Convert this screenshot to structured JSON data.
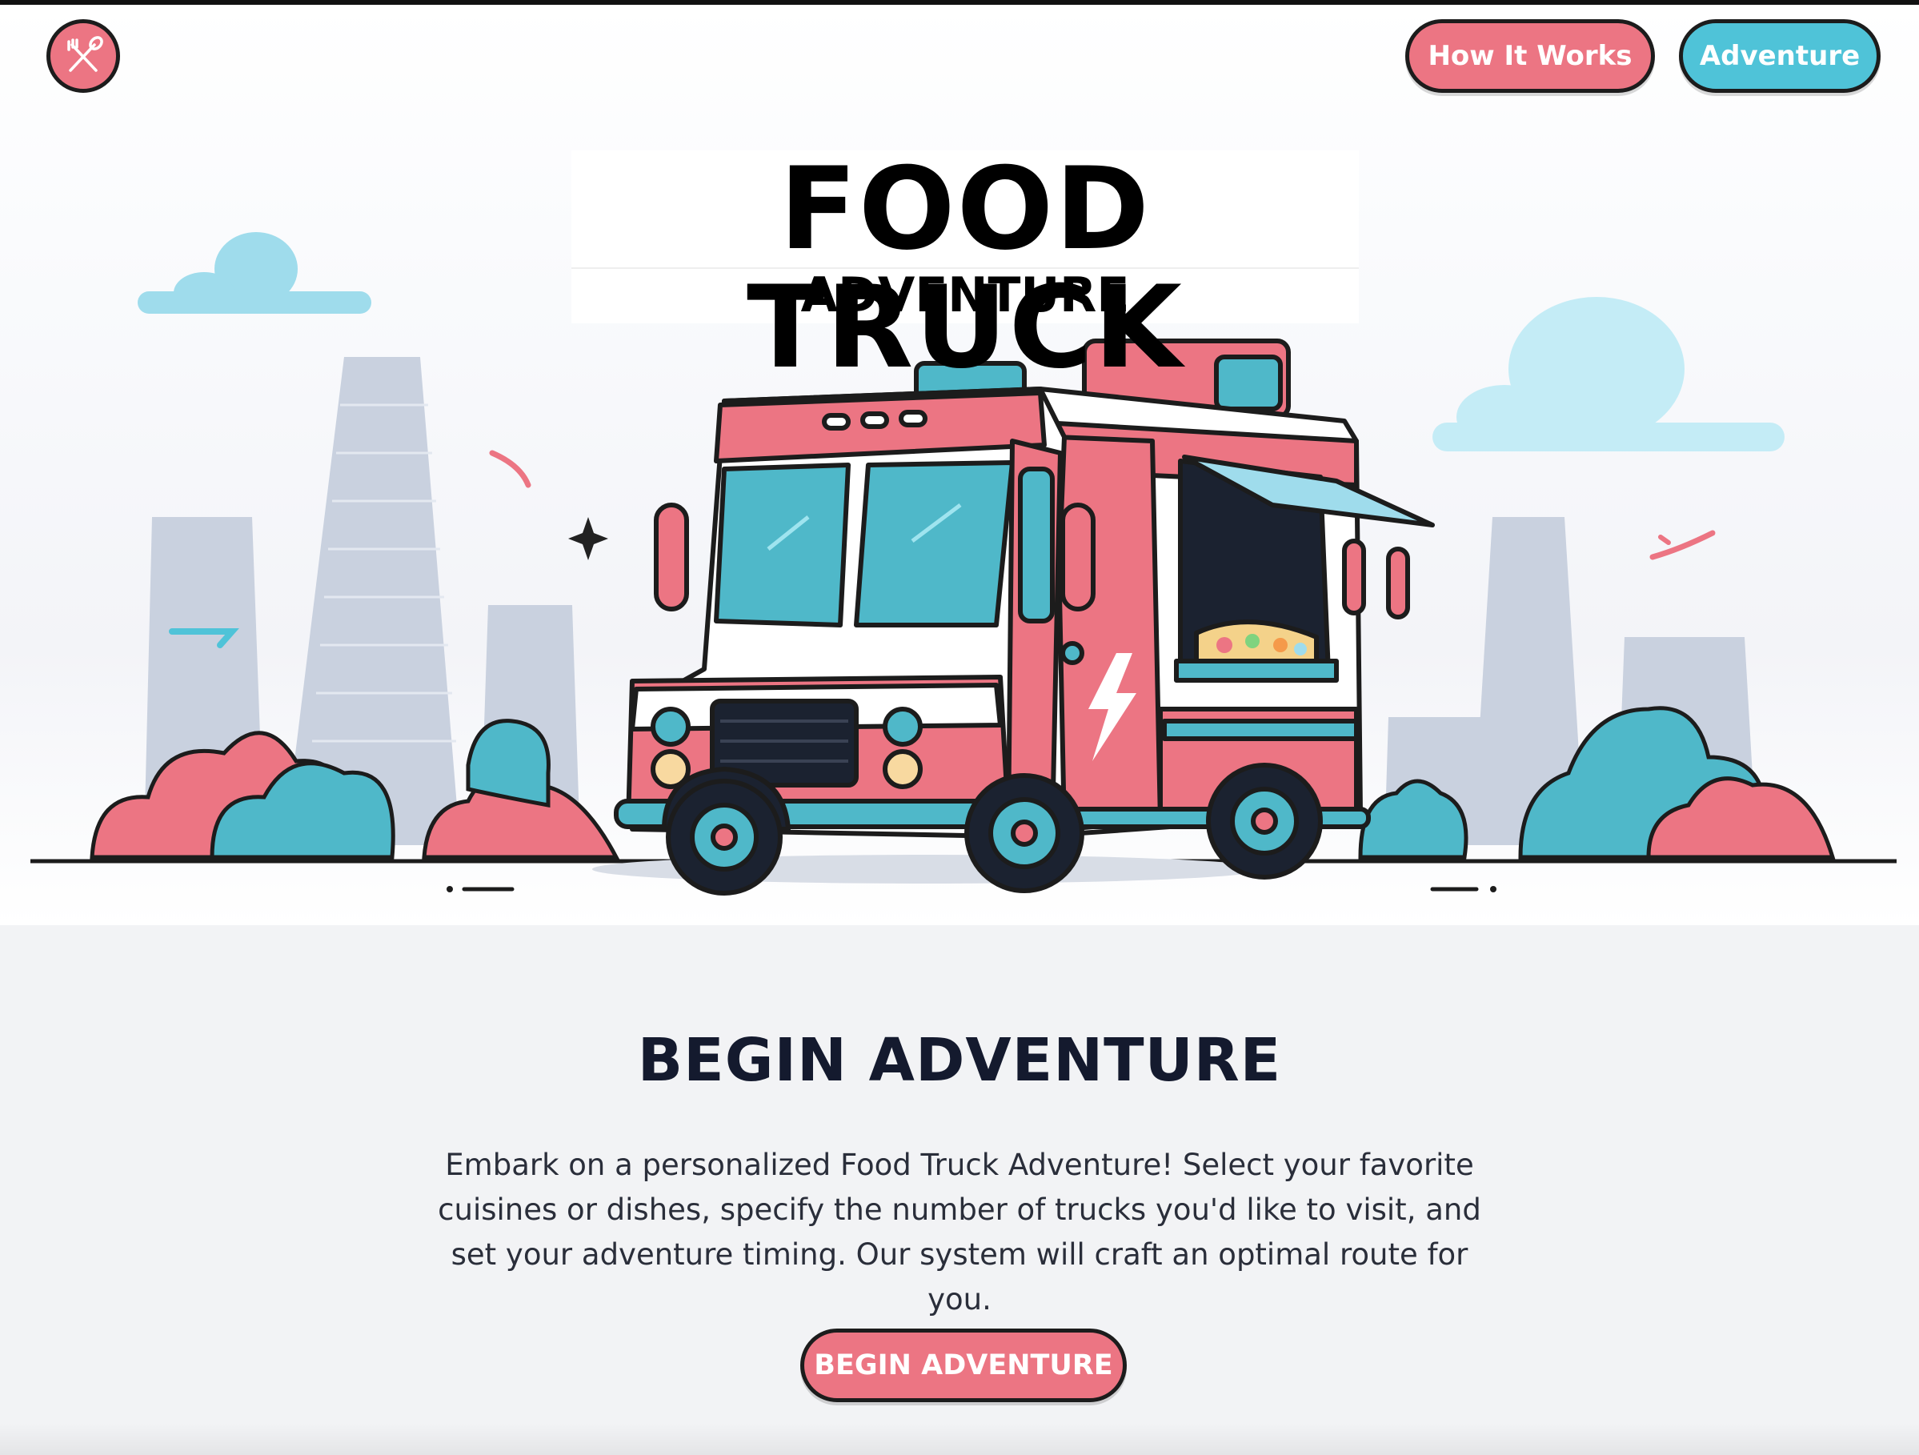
{
  "nav": {
    "logo_icon": "fork-spoon-icon",
    "how_it_works_label": "How It Works",
    "adventure_label": "Adventure"
  },
  "hero": {
    "title_line1": "FOOD TRUCK",
    "title_line2": "ADVENTURE",
    "illustration": "food-truck-city-illustration"
  },
  "intro": {
    "heading": "BEGIN ADVENTURE",
    "body": "Embark on a personalized Food Truck Adventure! Select your favorite cuisines or dishes, specify the number of trucks you'd like to visit, and set your adventure timing. Our system will craft an optimal route for you.",
    "cta_label": "BEGIN ADVENTURE"
  },
  "colors": {
    "pink": "#ec7583",
    "teal": "#4fc3d8",
    "dark_text": "#141a2e",
    "section_bg": "#f2f3f5"
  }
}
